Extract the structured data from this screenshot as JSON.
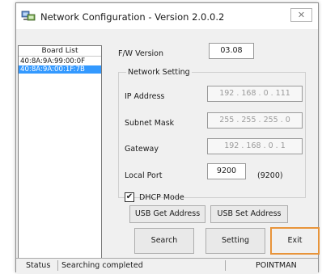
{
  "window": {
    "title": "Network Configuration - Version 2.0.0.2",
    "close_icon": "close-icon"
  },
  "board_list": {
    "header": "Board List",
    "items": [
      {
        "label": "40:8A:9A:99:00:0F",
        "selected": false
      },
      {
        "label": "40:8A:9A:00:1F:7B",
        "selected": true
      }
    ]
  },
  "firmware": {
    "label": "F/W Version",
    "value": "03.08"
  },
  "network": {
    "group_label": "Network Setting",
    "ip_label": "IP Address",
    "ip_value": "192  .  168  .   0   .  111",
    "mask_label": "Subnet Mask",
    "mask_value": "255  .  255  .  255  .   0",
    "gateway_label": "Gateway",
    "gateway_value": "192  .  168  .   0   .   1",
    "port_label": "Local Port",
    "port_value": "9200",
    "port_hint": "(9200)"
  },
  "dhcp": {
    "label": "DHCP Mode",
    "checked": true,
    "check_mark": "✔"
  },
  "buttons": {
    "usb_get": "USB Get Address",
    "usb_set": "USB Set Address",
    "search": "Search",
    "setting": "Setting",
    "exit": "Exit"
  },
  "status_bar": {
    "status_label": "Status",
    "status_text": "Searching completed",
    "brand": "POINTMAN"
  },
  "colors": {
    "selection": "#3399ff",
    "focus_border": "#e8943a"
  }
}
